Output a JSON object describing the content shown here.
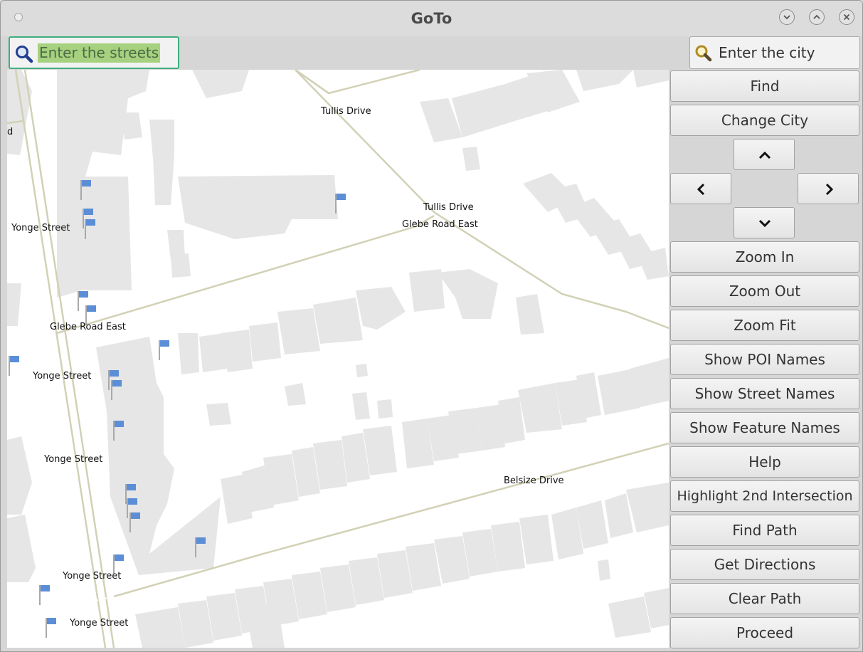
{
  "window": {
    "title": "GoTo"
  },
  "search": {
    "streets_placeholder": "Enter the streets",
    "city_placeholder": "Enter the city"
  },
  "buttons": {
    "find": "Find",
    "change_city": "Change City",
    "zoom_in": "Zoom In",
    "zoom_out": "Zoom Out",
    "zoom_fit": "Zoom Fit",
    "show_poi_names": "Show POI Names",
    "show_street_names": "Show Street Names",
    "show_feature_names": "Show Feature Names",
    "help": "Help",
    "highlight_2nd_intersection": "Highlight 2nd Intersection",
    "find_path": "Find Path",
    "get_directions": "Get Directions",
    "clear_path": "Clear Path",
    "proceed": "Proceed"
  },
  "map": {
    "labels": {
      "tullis_drive_1": "Tullis Drive",
      "tullis_drive_2": "Tullis Drive",
      "glebe_road_east_1": "Glebe Road East",
      "glebe_road_east_2": "Glebe Road East",
      "belsize_drive": "Belsize Drive",
      "yonge_street_1": "Yonge Street",
      "yonge_street_2": "Yonge Street",
      "yonge_street_3": "Yonge Street",
      "yonge_street_4": "Yonge Street",
      "yonge_street_5": "Yonge Street",
      "partial_d": "d"
    },
    "colors": {
      "road": "#d2d1b6",
      "building": "#e6e6e6",
      "poi_flag": "#5b8ed6"
    }
  },
  "icons": {
    "search_streets": "search-icon",
    "search_city": "search-icon",
    "pan_up": "chevron-up-icon",
    "pan_left": "chevron-left-icon",
    "pan_right": "chevron-right-icon",
    "pan_down": "chevron-down-icon"
  }
}
